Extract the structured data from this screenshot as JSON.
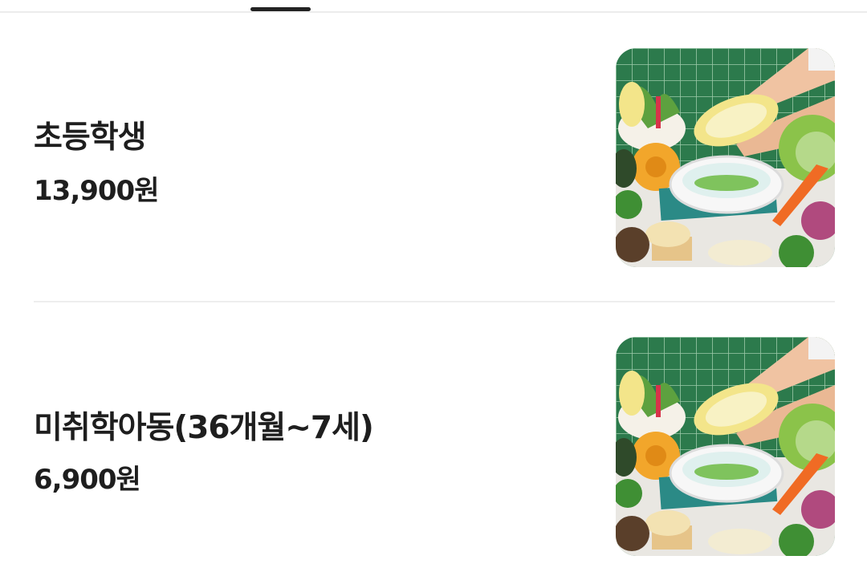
{
  "items": [
    {
      "name": "초등학생",
      "price": "13,900원",
      "image_icon": "vegetables-photo"
    },
    {
      "name": "미취학아동(36개월~7세)",
      "price": "6,900원",
      "image_icon": "vegetables-photo"
    }
  ],
  "colors": {
    "text": "#1e1e1e",
    "divider": "#eeeeee",
    "tile_green": "#2f7a4e"
  }
}
